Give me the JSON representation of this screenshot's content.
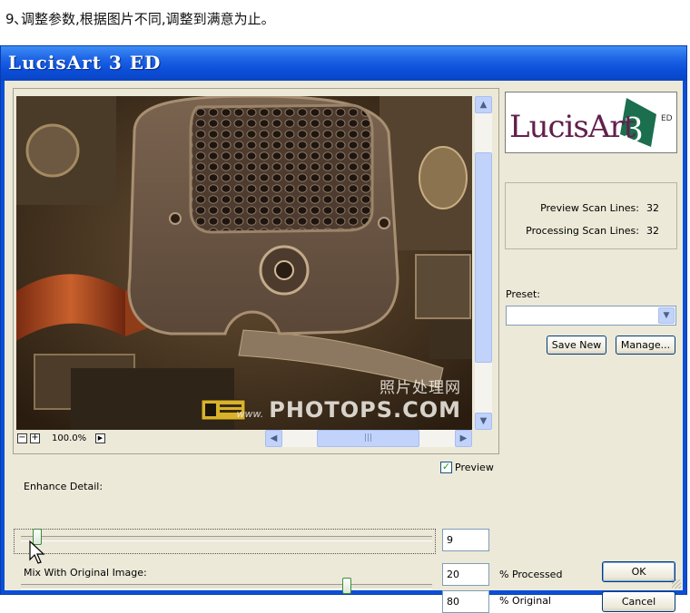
{
  "caption": "9､调整参数,根据图片不同,调整到满意为止。",
  "window": {
    "title": "LucisArt 3 ED"
  },
  "preview": {
    "zoom": "100.0%",
    "zoom_out_glyph": "−",
    "zoom_in_glyph": "+",
    "watermark_cn": "照片处理网",
    "watermark_www": "www.",
    "watermark_en": "PHOTOPS.COM",
    "checkbox_label": "Preview",
    "checkbox_checked": true,
    "vscroll_position": 0.25,
    "hscroll_position": 0.4
  },
  "logo": {
    "name": "LucisArt",
    "version": "3",
    "edition": "ED"
  },
  "scan": {
    "preview_label": "Preview Scan Lines:",
    "preview_value": "32",
    "processing_label": "Processing Scan Lines:",
    "processing_value": "32"
  },
  "preset": {
    "label": "Preset:",
    "value": "",
    "save_label": "Save New",
    "manage_label": "Manage..."
  },
  "enhance": {
    "label": "Enhance Detail:",
    "value": "9",
    "slider_fraction": 0.03
  },
  "mix": {
    "label": "Mix With Original Image:",
    "processed_value": "20",
    "processed_label": "% Processed",
    "original_value": "80",
    "original_label": "% Original",
    "slider_fraction": 0.8
  },
  "buttons": {
    "ok": "OK",
    "cancel": "Cancel"
  },
  "icons": {
    "vscroll_up": "chevron-up-icon",
    "vscroll_down": "chevron-down-icon",
    "hscroll_left": "chevron-left-icon",
    "hscroll_right": "chevron-right-icon",
    "preset_dropdown": "chevron-down-icon",
    "cursor": "mouse-pointer-icon"
  }
}
